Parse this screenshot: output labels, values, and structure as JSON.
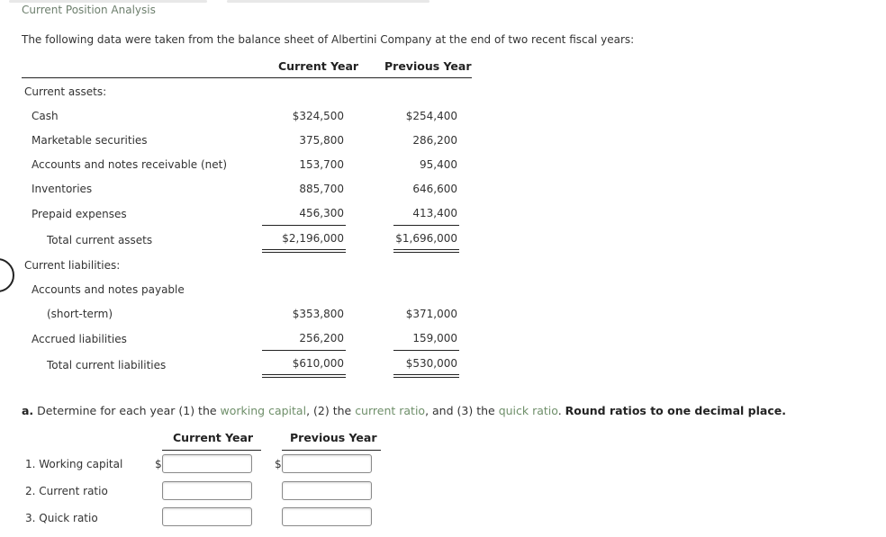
{
  "title": "Current Position Analysis",
  "intro": "The following data were taken from the balance sheet of Albertini Company at the end of two recent fiscal years:",
  "columns": {
    "current": "Current Year",
    "previous": "Previous Year"
  },
  "current_assets": {
    "heading": "Current assets:",
    "items": [
      {
        "label": "Cash",
        "current": "$324,500",
        "previous": "$254,400"
      },
      {
        "label": "Marketable securities",
        "current": "375,800",
        "previous": "286,200"
      },
      {
        "label": "Accounts and notes receivable (net)",
        "current": "153,700",
        "previous": "95,400"
      },
      {
        "label": "Inventories",
        "current": "885,700",
        "previous": "646,600"
      },
      {
        "label": "Prepaid expenses",
        "current": "456,300",
        "previous": "413,400"
      }
    ],
    "total": {
      "label": "Total current assets",
      "current": "$2,196,000",
      "previous": "$1,696,000"
    }
  },
  "current_liabilities": {
    "heading": "Current liabilities:",
    "items": [
      {
        "label": "Accounts and notes payable",
        "current": "",
        "previous": ""
      },
      {
        "label": "(short-term)",
        "current": "$353,800",
        "previous": "$371,000"
      },
      {
        "label": "Accrued liabilities",
        "current": "256,200",
        "previous": "159,000"
      }
    ],
    "total": {
      "label": "Total current liabilities",
      "current": "$610,000",
      "previous": "$530,000"
    }
  },
  "question": {
    "prefix": "a.",
    "text1": " Determine for each year (1) the ",
    "link1": "working capital",
    "text2": ", (2) the ",
    "link2": "current ratio",
    "text3": ", and (3) the ",
    "link3": "quick ratio",
    "text4": ". ",
    "instruction": "Round ratios to one decimal place."
  },
  "answers": {
    "columns": {
      "current": "Current Year",
      "previous": "Previous Year"
    },
    "currency_symbol": "$",
    "rows": [
      {
        "label": "1.  Working capital",
        "current": "",
        "previous": ""
      },
      {
        "label": "2.  Current ratio",
        "current": "",
        "previous": ""
      },
      {
        "label": "3.  Quick ratio",
        "current": "",
        "previous": ""
      }
    ]
  },
  "colors": {
    "link": "#6f8f6a",
    "title": "#6d7f6d"
  }
}
